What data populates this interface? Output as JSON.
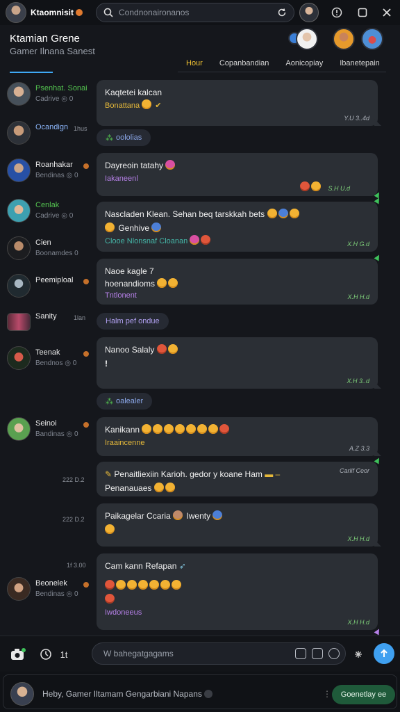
{
  "topbar": {
    "app_title": "Ktaomnisit",
    "search_placeholder": "Condnonaironanos"
  },
  "header": {
    "title": "Ktamian Grene",
    "subtitle": "Gamer Ilnana Sanest",
    "tabs": [
      {
        "label": "Hour",
        "active": true
      },
      {
        "label": "Copanbandian",
        "active": false
      },
      {
        "label": "Aonicopiay",
        "active": false
      },
      {
        "label": "Ibanetepain",
        "active": false
      }
    ]
  },
  "participants": [
    {
      "name": "Psenhat. Sonai",
      "status": "Cadrive ◎ 0"
    },
    {
      "name": "Ocandign",
      "time": "1hus"
    },
    {
      "name": "Roanhakar",
      "status": "Bendinas ◎ 0"
    },
    {
      "name": "Cenlak",
      "status": "Cadrive ◎ 0"
    },
    {
      "name": "Cien",
      "status": "Boonamdes 0"
    },
    {
      "name": "Peemiploal"
    },
    {
      "name": "Sanity",
      "time": "1lan"
    },
    {
      "name": "Teenak",
      "status": "Bendnos ◎ 0"
    },
    {
      "name": "Seinoi",
      "status": "Bandinas ◎ 0"
    },
    {
      "name": "Beonelek",
      "status": "Bendinas ◎ 0"
    }
  ],
  "row_times": [
    "222 D.2",
    "222 D.2",
    "1f 3.00"
  ],
  "messages": [
    {
      "line1": "Kaqtetei kalcan",
      "line2": "Bonattana",
      "time": "Y.U 3..4d"
    },
    {
      "pill": "oololias"
    },
    {
      "line1": "Dayreoin tatahy",
      "line2": "Iakaneenl",
      "time": "S.H U.d"
    },
    {
      "line1": "Nascladen Klean. Sehan beq tarskkah bets",
      "line2": "Genhive",
      "line3": "Clooe  Nlonsnaf Cloanan",
      "time": "X.H G.d"
    },
    {
      "line1": "Naoe kagle 7",
      "line2": "hoenandioms",
      "line3": "Tntlonent",
      "time": "X.H H.d"
    },
    {
      "pill": "Halm pef ondue"
    },
    {
      "line1": "Nanoo Salaly",
      "line2": "!",
      "time": "X.H 3..d"
    },
    {
      "pill": "oalealer"
    },
    {
      "line1": "Kanikann",
      "line2": "Iraaincenne",
      "time": "A.Z 3.3"
    },
    {
      "line1": "Penaitliexiin Karioh. gedor y koane Ham",
      "line2": "Penanauaes",
      "time_top": "Carlif Ceor"
    },
    {
      "line1": "Paikagelar Ccaria",
      "line1b": "Iwenty",
      "time": "X.H H.d"
    },
    {
      "line1": "Cam kann Refapan",
      "line3": "Iwdoneeus",
      "time": "X.H H.d"
    }
  ],
  "composer": {
    "placeholder": "W bahegatgagams",
    "counter": "1t"
  },
  "footer": {
    "text": "Heby, Gamer Iltamam Gengarbiani Napans",
    "button_label": "Goenetlay ee"
  },
  "colors": {
    "accent": "#3fa0f0",
    "bubble": "#2b2f35",
    "timestamp_green": "#53c24f",
    "active_tab": "#f1c232"
  }
}
